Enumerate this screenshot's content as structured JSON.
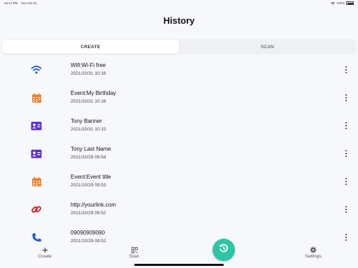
{
  "status": {
    "time": "10:17 PM",
    "date": "Sun Oct 31",
    "battery": "100%"
  },
  "header": {
    "title": "History"
  },
  "segments": [
    {
      "label": "CREATE",
      "active": true
    },
    {
      "label": "SCAN",
      "active": false
    }
  ],
  "items": [
    {
      "icon": "wifi-icon",
      "color": "#1f5bd8",
      "title": "Wifi:Wi-Fi free",
      "date": "2021/10/31 10:16"
    },
    {
      "icon": "calendar-icon",
      "color": "#f07b24",
      "title": "Event:My Birthday",
      "date": "2021/10/31 10:16"
    },
    {
      "icon": "contact-card-icon",
      "color": "#5b2bd6",
      "title": "Tony Banner",
      "date": "2021/10/31 10:15"
    },
    {
      "icon": "contact-card-icon",
      "color": "#5b2bd6",
      "title": "Tony Last Name",
      "date": "2021/10/29 09:54"
    },
    {
      "icon": "calendar-icon",
      "color": "#f07b24",
      "title": "Event:Event title",
      "date": "2021/10/29 09:53"
    },
    {
      "icon": "link-icon",
      "color": "#d42a2a",
      "title": "http://yourlink.com",
      "date": "2021/10/29 09:52"
    },
    {
      "icon": "phone-icon",
      "color": "#1f5bd8",
      "title": "09090909090",
      "date": "2021/10/29 09:52"
    }
  ],
  "tabbar": {
    "create_label": "Create",
    "scan_label": "Scan",
    "settings_label": "Settings",
    "fab_icon": "history-icon",
    "fab_color": "#2ec4a6"
  }
}
